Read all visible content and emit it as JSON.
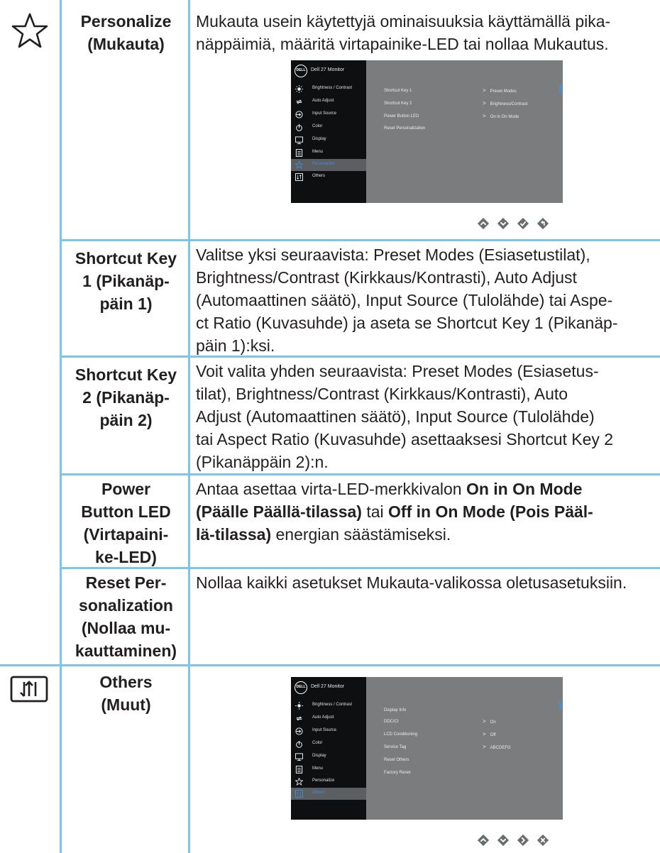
{
  "rows": {
    "personalize": {
      "name": "Personalize (Mukauta)",
      "name_lines": [
        "Personalize",
        "(Mukauta)"
      ],
      "desc_lines": [
        "Mukauta usein käytettyjä ominaisuuksia käyttämällä pika-",
        "näppäimiä, määritä virtapainike-LED tai nollaa Mukautus."
      ],
      "icon": "star-outline-icon"
    },
    "shortcut1": {
      "name_lines": [
        "Shortcut Key",
        "1 (Pikanäp-",
        "päin 1)"
      ],
      "desc_lines": [
        "Valitse yksi seuraavista: Preset Modes (Esiasetustilat),",
        "Brightness/Contrast (Kirkkaus/Kontrasti), Auto Adjust",
        "(Automaattinen säätö), Input Source (Tulolähde) tai Aspe-",
        "ct Ratio (Kuvasuhde) ja aseta se Shortcut Key 1 (Pikanäp-",
        "päin 1):ksi."
      ]
    },
    "shortcut2": {
      "name_lines": [
        "Shortcut Key",
        "2 (Pikanäp-",
        "päin 2)"
      ],
      "desc_lines": [
        "Voit valita yhden seuraavista: Preset Modes (Esiasetus-",
        "tilat), Brightness/Contrast (Kirkkaus/Kontrasti), Auto",
        "Adjust (Automaattinen säätö), Input Source (Tulolähde)",
        "tai Aspect Ratio (Kuvasuhde) asettaaksesi Shortcut Key 2",
        "(Pikanäppäin 2):n."
      ]
    },
    "powerled": {
      "name_lines": [
        "Power",
        "Button LED",
        "(Virtapaini-",
        "ke-LED)"
      ],
      "desc_l1_a": "Antaa asettaa virta-LED-merkkivalon ",
      "desc_l1_b": "On in On Mode",
      "desc_l2_a": "(Päälle Päällä-tilassa)",
      "desc_l2_b": " tai ",
      "desc_l2_c": "Off in On Mode (Pois Pääl-",
      "desc_l3_a": "lä-tilassa)",
      "desc_l3_b": " energian säästämiseksi."
    },
    "reset": {
      "name_lines": [
        "Reset Per-",
        "sonalization",
        "(Nollaa mu-",
        "kauttaminen)"
      ],
      "desc": "Nollaa kaikki asetukset Mukauta-valikossa oletusasetuksiin."
    },
    "others": {
      "name_lines": [
        "Others",
        "(Muut)"
      ],
      "icon": "others-menu-icon"
    }
  },
  "osd1": {
    "logo": "DELL",
    "title": "Dell 27 Monitor",
    "menu": [
      "Brightness / Contrast",
      "Auto Adjust",
      "Input Source",
      "Color",
      "Display",
      "Menu",
      "Personalize",
      "Others"
    ],
    "selected_index": 6,
    "options": [
      "Shortcut Key 1",
      "Shortcut Key 2",
      "Power Button LED",
      "Reset Personalization"
    ],
    "values": [
      "Preset Modes",
      "Brightness/Contrast",
      "On in On Mode"
    ]
  },
  "osd2": {
    "logo": "DELL",
    "title": "Dell 27 Monitor",
    "menu": [
      "Brightness / Contrast",
      "Auto Adjust",
      "Input Source",
      "Color",
      "Display",
      "Menu",
      "Personalize",
      "Others"
    ],
    "selected_index": 7,
    "options": [
      "Display Info",
      "DDC/CI",
      "LCD Conditioning",
      "Service Tag",
      "Reset Others",
      "Factory Reset"
    ],
    "values": [
      "On",
      "Off",
      "ABCDEFG"
    ]
  },
  "colors": {
    "grid": "#7fc3e6",
    "osd_bg": "#7a7c7e",
    "osd_side": "#0e0f10",
    "osd_select": "#3f8fd8",
    "nav_button": "#6a6d70"
  },
  "nav1": [
    "up-icon",
    "down-icon",
    "check-icon",
    "back-icon"
  ],
  "nav2": [
    "up-icon",
    "down-icon",
    "right-icon",
    "close-icon"
  ]
}
